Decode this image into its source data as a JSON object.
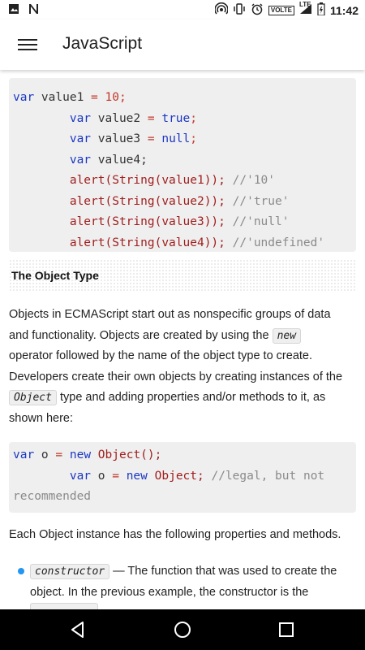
{
  "status_bar": {
    "time": "11:42",
    "network": "LTE",
    "volte": "VOLTE"
  },
  "app_bar": {
    "title": "JavaScript"
  },
  "code_block_1": {
    "lines": [
      [
        {
          "t": "var",
          "c": "kw"
        },
        {
          "t": " value1 ",
          "c": "nm"
        },
        {
          "t": "=",
          "c": "op"
        },
        {
          "t": " ",
          "c": "nm"
        },
        {
          "t": "10",
          "c": "num"
        },
        {
          "t": ";",
          "c": "op"
        }
      ],
      [
        {
          "t": "        var",
          "c": "kw"
        },
        {
          "t": " value2 ",
          "c": "nm"
        },
        {
          "t": "=",
          "c": "op"
        },
        {
          "t": " ",
          "c": "nm"
        },
        {
          "t": "true",
          "c": "lit"
        },
        {
          "t": ";",
          "c": "op"
        }
      ],
      [
        {
          "t": "        var",
          "c": "kw"
        },
        {
          "t": " value3 ",
          "c": "nm"
        },
        {
          "t": "=",
          "c": "op"
        },
        {
          "t": " ",
          "c": "nm"
        },
        {
          "t": "null",
          "c": "lit"
        },
        {
          "t": ";",
          "c": "op"
        }
      ],
      [
        {
          "t": "        var",
          "c": "kw"
        },
        {
          "t": " value4;",
          "c": "nm"
        }
      ],
      [
        {
          "t": "        alert(String(value1)); ",
          "c": "fn"
        },
        {
          "t": "//'10'",
          "c": "cm"
        }
      ],
      [
        {
          "t": "        alert(String(value2)); ",
          "c": "fn"
        },
        {
          "t": "//'true'",
          "c": "cm"
        }
      ],
      [
        {
          "t": "        alert(String(value3)); ",
          "c": "fn"
        },
        {
          "t": "//'null'",
          "c": "cm"
        }
      ],
      [
        {
          "t": "        alert(String(value4)); ",
          "c": "fn"
        },
        {
          "t": "//'undefined'",
          "c": "cm"
        }
      ]
    ]
  },
  "section": {
    "heading": "The Object Type"
  },
  "paragraph_1": {
    "line1": "Objects in ECMAScript start out as nonspecific groups of data",
    "line2_pre": "and functionality. Objects are created by using the ",
    "code_new": "new",
    "line3": "operator followed by the name of the object type to create.",
    "line4": "Developers create their own objects by creating instances of the",
    "code_object": "Object",
    "line5_post": " type and adding properties and/or methods to it, as",
    "line6": "shown here:"
  },
  "code_block_2": {
    "lines": [
      [
        {
          "t": "var",
          "c": "kw"
        },
        {
          "t": " o ",
          "c": "nm"
        },
        {
          "t": "=",
          "c": "op"
        },
        {
          "t": " ",
          "c": "nm"
        },
        {
          "t": "new",
          "c": "kw"
        },
        {
          "t": " Object();",
          "c": "fn"
        }
      ],
      [
        {
          "t": "        var",
          "c": "kw"
        },
        {
          "t": " o ",
          "c": "nm"
        },
        {
          "t": "=",
          "c": "op"
        },
        {
          "t": " ",
          "c": "nm"
        },
        {
          "t": "new",
          "c": "kw"
        },
        {
          "t": " Object; ",
          "c": "fn"
        },
        {
          "t": "//legal, but not",
          "c": "cm"
        }
      ],
      [
        {
          "t": "recommended",
          "c": "cm"
        }
      ]
    ]
  },
  "paragraph_2": {
    "text": "Each Object instance has the following properties and methods."
  },
  "list": {
    "item1_code": "constructor",
    "item1_text_a": " — The function that was used to create the",
    "item1_text_b": "object. In the previous example, the constructor is the"
  },
  "colors": {
    "keyword": "#1a37c4",
    "literal": "#c0392b",
    "function": "#a11d1d",
    "comment": "#8a8a8a",
    "bullet": "#2196f3"
  }
}
